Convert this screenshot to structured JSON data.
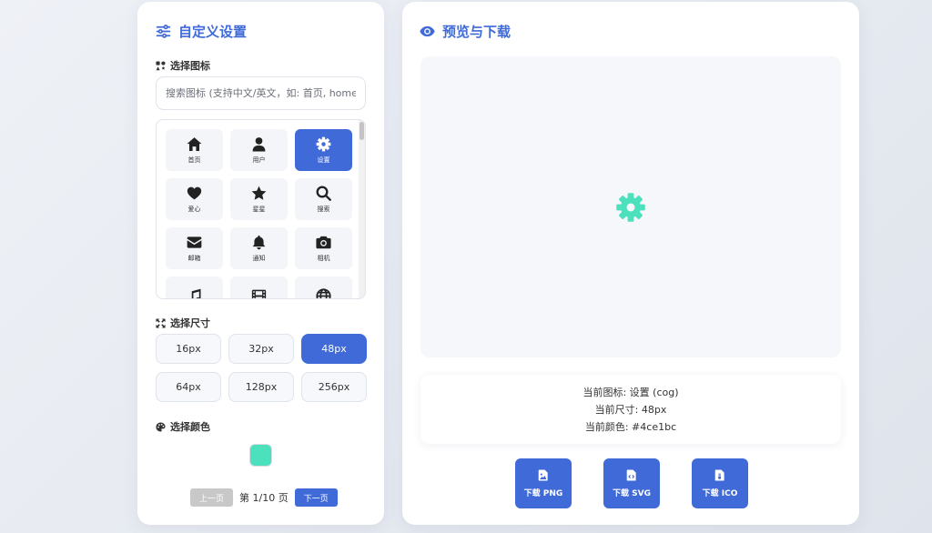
{
  "left_panel": {
    "title": "自定义设置",
    "icon_section": "选择图标",
    "search_placeholder": "搜索图标 (支持中文/英文，如: 首页, home, u",
    "icons": [
      {
        "icon": "home-icon",
        "label": "首页",
        "active": false
      },
      {
        "icon": "user-icon",
        "label": "用户",
        "active": false
      },
      {
        "icon": "cog-icon",
        "label": "设置",
        "active": true
      },
      {
        "icon": "heart-icon",
        "label": "爱心",
        "active": false
      },
      {
        "icon": "star-icon",
        "label": "星星",
        "active": false
      },
      {
        "icon": "search-icon",
        "label": "搜索",
        "active": false
      },
      {
        "icon": "envelope-icon",
        "label": "邮箱",
        "active": false
      },
      {
        "icon": "bell-icon",
        "label": "通知",
        "active": false
      },
      {
        "icon": "camera-icon",
        "label": "相机",
        "active": false
      },
      {
        "icon": "music-icon",
        "label": "",
        "active": false
      },
      {
        "icon": "film-icon",
        "label": "",
        "active": false
      },
      {
        "icon": "globe-icon",
        "label": "",
        "active": false
      }
    ],
    "size_section": "选择尺寸",
    "sizes": [
      "16px",
      "32px",
      "48px",
      "64px",
      "128px",
      "256px"
    ],
    "selected_size_index": 2,
    "color_section": "选择颜色",
    "selected_color": "#4ce1bc",
    "pagination": {
      "prev": "上一页",
      "status": "第 1/10 页",
      "next": "下一页"
    }
  },
  "right_panel": {
    "title": "预览与下载",
    "info": {
      "icon_line": "当前图标: 设置 (cog)",
      "size_line": "当前尺寸: 48px",
      "color_line": "当前颜色: #4ce1bc"
    },
    "downloads": [
      {
        "icon": "file-image-icon",
        "label": "下载 PNG"
      },
      {
        "icon": "file-code-icon",
        "label": "下载 SVG"
      },
      {
        "icon": "file-ico-icon",
        "label": "下载 ICO"
      }
    ]
  },
  "colors": {
    "accent": "#3f6ad8",
    "preview_icon": "#4ce1bc"
  }
}
